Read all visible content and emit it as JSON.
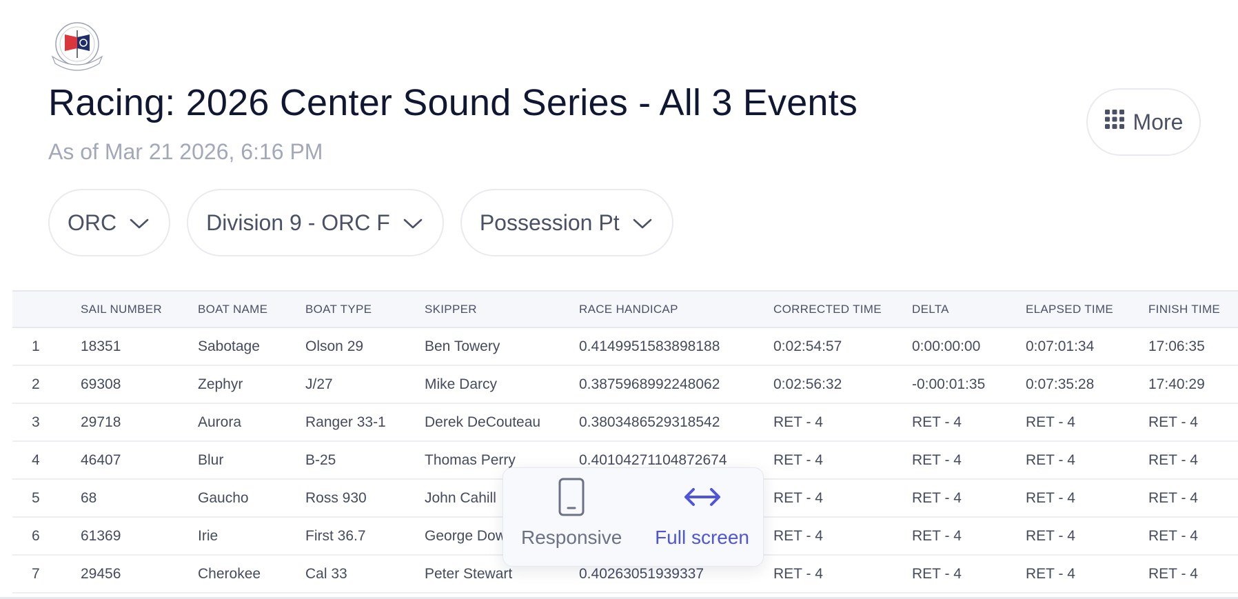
{
  "header": {
    "title": "Racing: 2026 Center Sound Series - All 3 Events",
    "subtitle": "As of Mar 21 2026, 6:16 PM",
    "more_label": "More"
  },
  "filters": [
    {
      "label": "ORC"
    },
    {
      "label": "Division 9 - ORC F"
    },
    {
      "label": "Possession Pt"
    }
  ],
  "table": {
    "columns": [
      "",
      "SAIL NUMBER",
      "BOAT NAME",
      "BOAT TYPE",
      "SKIPPER",
      "RACE HANDICAP",
      "CORRECTED TIME",
      "DELTA",
      "ELAPSED TIME",
      "FINISH TIME"
    ],
    "rows": [
      [
        "1",
        "18351",
        "Sabotage",
        "Olson 29",
        "Ben Towery",
        "0.4149951583898188",
        "0:02:54:57",
        "0:00:00:00",
        "0:07:01:34",
        "17:06:35"
      ],
      [
        "2",
        "69308",
        "Zephyr",
        "J/27",
        "Mike Darcy",
        "0.3875968992248062",
        "0:02:56:32",
        "-0:00:01:35",
        "0:07:35:28",
        "17:40:29"
      ],
      [
        "3",
        "29718",
        "Aurora",
        "Ranger 33-1",
        "Derek DeCouteau",
        "0.3803486529318542",
        "RET - 4",
        "RET - 4",
        "RET - 4",
        "RET - 4"
      ],
      [
        "4",
        "46407",
        "Blur",
        "B-25",
        "Thomas Perry",
        "0.40104271104872674",
        "RET - 4",
        "RET - 4",
        "RET - 4",
        "RET - 4"
      ],
      [
        "5",
        "68",
        "Gaucho",
        "Ross 930",
        "John Cahill",
        "",
        "RET - 4",
        "RET - 4",
        "RET - 4",
        "RET - 4"
      ],
      [
        "6",
        "61369",
        "Irie",
        "First 36.7",
        "George Dow",
        "",
        "RET - 4",
        "RET - 4",
        "RET - 4",
        "RET - 4"
      ],
      [
        "7",
        "29456",
        "Cherokee",
        "Cal 33",
        "Peter Stewart",
        "0.40263051939337",
        "RET - 4",
        "RET - 4",
        "RET - 4",
        "RET - 4"
      ]
    ]
  },
  "view_popup": {
    "responsive_label": "Responsive",
    "full_label": "Full screen",
    "responsive_icon": "phone-icon",
    "full_icon": "horizontal-arrows-icon",
    "active_color": "#4f55d9"
  },
  "colors": {
    "title": "#0f1733",
    "muted": "#a3a8b8",
    "accent": "#4f55d9",
    "burgee_red": "#d9363e",
    "burgee_navy": "#1f2d6b"
  }
}
